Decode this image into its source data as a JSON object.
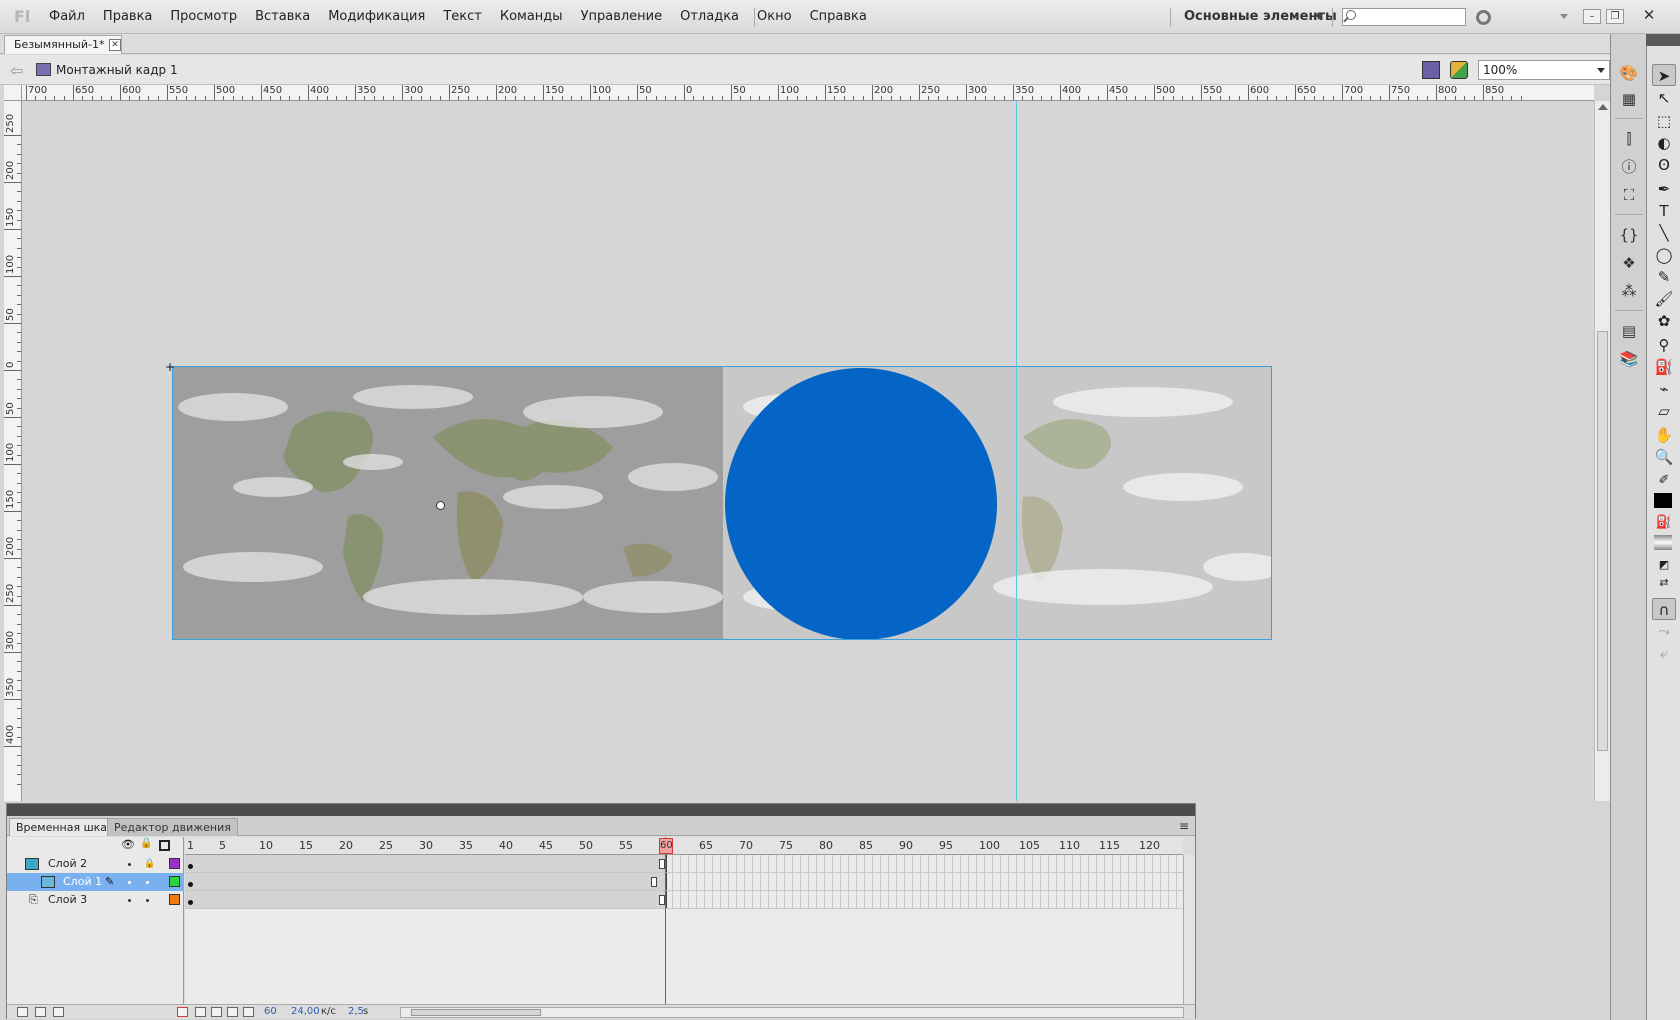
{
  "app": {
    "logo": "Fl",
    "menu": [
      "Файл",
      "Правка",
      "Просмотр",
      "Вставка",
      "Модификация",
      "Текст",
      "Команды",
      "Управление",
      "Отладка",
      "Окно",
      "Справка"
    ],
    "workspace": "Основные элементы",
    "search_placeholder": ""
  },
  "document": {
    "tab_title": "Безымянный-1*",
    "scene_label": "Монтажный кадр 1",
    "zoom": "100%"
  },
  "rulers": {
    "horizontal": [
      "700",
      "650",
      "600",
      "550",
      "500",
      "450",
      "400",
      "350",
      "300",
      "250",
      "200",
      "150",
      "100",
      "50",
      "0",
      "50",
      "100",
      "150",
      "200",
      "250",
      "300",
      "350",
      "400",
      "450",
      "500",
      "550",
      "600",
      "650",
      "700",
      "750",
      "800",
      "850"
    ],
    "vertical": [
      "250",
      "200",
      "150",
      "100",
      "50",
      "0",
      "50",
      "100",
      "150",
      "200",
      "250",
      "300",
      "350",
      "400"
    ]
  },
  "stage": {
    "circle_color": "#0565c6",
    "guide_color": "#59c8e0",
    "selection_color": "#3aa0e0"
  },
  "timeline": {
    "tabs": [
      "Временная шкала",
      "Редактор движения"
    ],
    "frame_numbers": [
      "1",
      "5",
      "10",
      "15",
      "20",
      "25",
      "30",
      "35",
      "40",
      "45",
      "50",
      "55",
      "60",
      "65",
      "70",
      "75",
      "80",
      "85",
      "90",
      "95",
      "100",
      "105",
      "110",
      "115",
      "120"
    ],
    "current_frame_marker": "60",
    "layers": [
      {
        "name": "Слой 2",
        "color": "#9b30c8",
        "selected": false
      },
      {
        "name": "Слой 1",
        "color": "#2cd43c",
        "selected": true
      },
      {
        "name": "Слой 3",
        "color": "#f07c10",
        "selected": false
      }
    ],
    "footer": {
      "current_frame": "60",
      "fps_value": "24,00",
      "fps_unit": "к/с",
      "time_value": "2,5",
      "time_unit": "s"
    }
  },
  "tools": [
    "selection",
    "subselection",
    "free-transform",
    "3d-rotation",
    "lasso",
    "pen",
    "text",
    "line",
    "oval",
    "pencil",
    "brush",
    "deco",
    "bone",
    "paint-bucket",
    "eyedropper",
    "eraser",
    "hand",
    "zoom",
    "stroke-color",
    "fill-color",
    "swap-colors",
    "snap"
  ]
}
